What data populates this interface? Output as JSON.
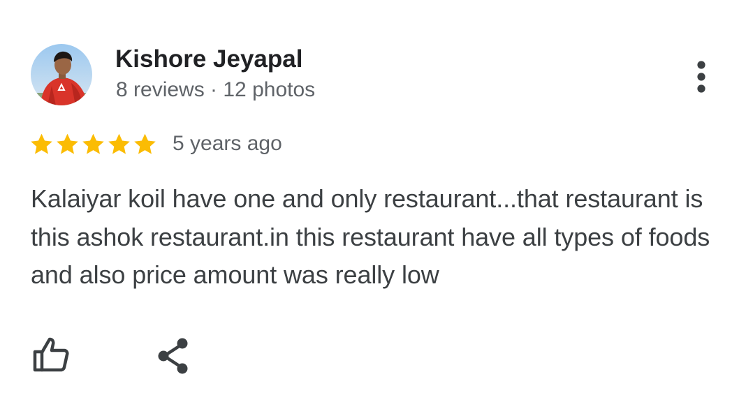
{
  "review": {
    "author": {
      "name": "Kishore Jeyapal",
      "meta": "8 reviews · 12 photos"
    },
    "rating": {
      "value": 5,
      "max": 5,
      "star_color": "#fbbc04"
    },
    "date": "5 years ago",
    "text": "Kalaiyar koil have one and only restaurant...that restaurant is this ashok restaurant.in this restaurant have all types of foods and also price amount was really low",
    "icons": {
      "more": "more-vert-icon",
      "like": "thumb-up-icon",
      "share": "share-icon"
    },
    "colors": {
      "name": "#202124",
      "meta": "#5f6368",
      "body": "#3c4043",
      "icon": "#3c4043"
    }
  }
}
